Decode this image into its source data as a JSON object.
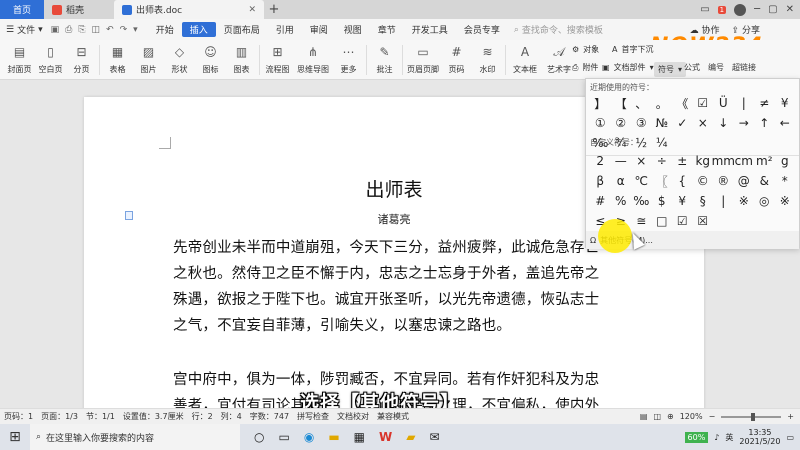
{
  "titlebar": {
    "tabs": [
      {
        "label": "首页"
      },
      {
        "label": "稻壳"
      },
      {
        "label": "出师表.doc"
      }
    ],
    "new_tab": "+",
    "badge": "1"
  },
  "menubar": {
    "file_label": "文件",
    "items": [
      "开始",
      "插入",
      "页面布局",
      "引用",
      "审阅",
      "视图",
      "章节",
      "开发工具",
      "会员专享"
    ],
    "active": "插入",
    "search_placeholder": "查找命令、搜索模板",
    "right": [
      "协作",
      "分享"
    ]
  },
  "ribbon": {
    "buttons": [
      "封面页",
      "空白页",
      "分页",
      "表格",
      "图片",
      "形状",
      "图标",
      "图表",
      "流程图",
      "思维导图",
      "更多",
      "批注",
      "页眉页脚",
      "页码",
      "水印",
      "文本框",
      "艺术字"
    ],
    "right_top": [
      "对象",
      "首字下沉"
    ],
    "right_bottom": [
      "附件",
      "文档部件",
      "符号",
      "公式",
      "编号",
      "超链接"
    ]
  },
  "document": {
    "title": "出师表",
    "author": "诸葛亮",
    "paragraphs": [
      "先帝创业未半而中道崩殂，今天下三分，益州疲弊，此诚危急存亡之秋也。然侍卫之臣不懈于内，忠志之士忘身于外者，盖追先帝之殊遇，欲报之于陛下也。诚宜开张圣听，以光先帝遗德，恢弘志士之气，不宜妄自菲薄，引喻失义，以塞忠谏之路也。",
      "宫中府中，俱为一体，陟罚臧否，不宜异同。若有作奸犯科及为忠善者，宜付有司论其刑赏，以昭陛下平明之理，不宜偏私，使内外异法也。"
    ]
  },
  "symbol_panel": {
    "recent_label": "近期使用的符号：",
    "recent": [
      "】",
      "【",
      "、",
      "。",
      "《",
      "☑",
      "Ü",
      "|",
      "≠",
      "¥",
      "①",
      "②",
      "③",
      "№",
      "✓",
      "×",
      "↓",
      "→",
      "↑",
      "←",
      "‰",
      "¾",
      "½",
      "¼"
    ],
    "custom_label": "自定义符号：",
    "custom": [
      "2",
      "—",
      "×",
      "÷",
      "±",
      "kg",
      "mm",
      "cm",
      "m²",
      "g",
      "β",
      "α",
      "℃",
      "〖",
      "{",
      "©",
      "®",
      "@",
      "&",
      "*",
      "#",
      "%",
      "‰",
      "$",
      "¥",
      "§",
      "|",
      "※",
      "◎",
      "※",
      "≤",
      "≥",
      "≅",
      "□",
      "☑",
      "☒"
    ],
    "other_label": "其他符号(M)..."
  },
  "watermark_logo": "NQW234",
  "subtitle": "选择【其他符号】",
  "statusbar": {
    "items": [
      "页码：1",
      "页面：1/3",
      "节：1/1",
      "设置值：3.7厘米",
      "行：2",
      "列：4",
      "字数：747",
      "拼写检查",
      "文档校对",
      "兼容模式"
    ],
    "zoom": "120%"
  },
  "taskbar": {
    "search_placeholder": "在这里输入你要搜索的内容",
    "battery": "60%",
    "lang": "英",
    "time": "13:35",
    "date": "2021/5/20"
  }
}
